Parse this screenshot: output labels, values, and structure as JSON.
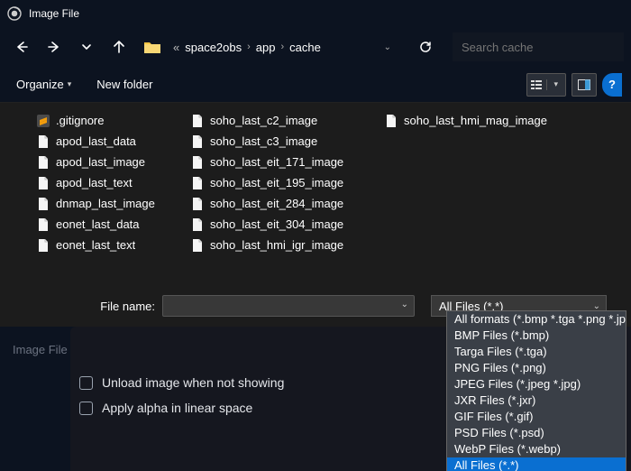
{
  "title": "Image File",
  "breadcrumbs": {
    "prefix": "«",
    "items": [
      "space2obs",
      "app",
      "cache"
    ]
  },
  "search_placeholder": "Search cache",
  "toolbar": {
    "organize": "Organize",
    "newfolder": "New folder",
    "help": "?"
  },
  "files": {
    "col1": [
      {
        "name": ".gitignore",
        "icon": "sublime"
      },
      {
        "name": "apod_last_data",
        "icon": "file"
      },
      {
        "name": "apod_last_image",
        "icon": "file"
      },
      {
        "name": "apod_last_text",
        "icon": "file"
      },
      {
        "name": "dnmap_last_image",
        "icon": "file"
      },
      {
        "name": "eonet_last_data",
        "icon": "file"
      },
      {
        "name": "eonet_last_text",
        "icon": "file"
      }
    ],
    "col2": [
      {
        "name": "soho_last_c2_image",
        "icon": "file"
      },
      {
        "name": "soho_last_c3_image",
        "icon": "file"
      },
      {
        "name": "soho_last_eit_171_image",
        "icon": "file"
      },
      {
        "name": "soho_last_eit_195_image",
        "icon": "file"
      },
      {
        "name": "soho_last_eit_284_image",
        "icon": "file"
      },
      {
        "name": "soho_last_eit_304_image",
        "icon": "file"
      },
      {
        "name": "soho_last_hmi_igr_image",
        "icon": "file"
      }
    ],
    "col3": [
      {
        "name": "soho_last_hmi_mag_image",
        "icon": "file"
      }
    ]
  },
  "filename": {
    "label": "File name:",
    "value": ""
  },
  "filetype": {
    "selected": "All Files (*.*)",
    "options": [
      "All formats (*.bmp *.tga *.png *.jpeg *.jpg *.jxr *.gif *.psd *.webp)",
      "BMP Files (*.bmp)",
      "Targa Files (*.tga)",
      "PNG Files (*.png)",
      "JPEG Files (*.jpeg *.jpg)",
      "JXR Files (*.jxr)",
      "GIF Files (*.gif)",
      "PSD Files (*.psd)",
      "WebP Files (*.webp)",
      "All Files (*.*)"
    ],
    "highlighted_index": 9
  },
  "underlay": {
    "heading": "Image File",
    "check_unload": "Unload image when not showing",
    "check_alpha": "Apply alpha in linear space"
  }
}
